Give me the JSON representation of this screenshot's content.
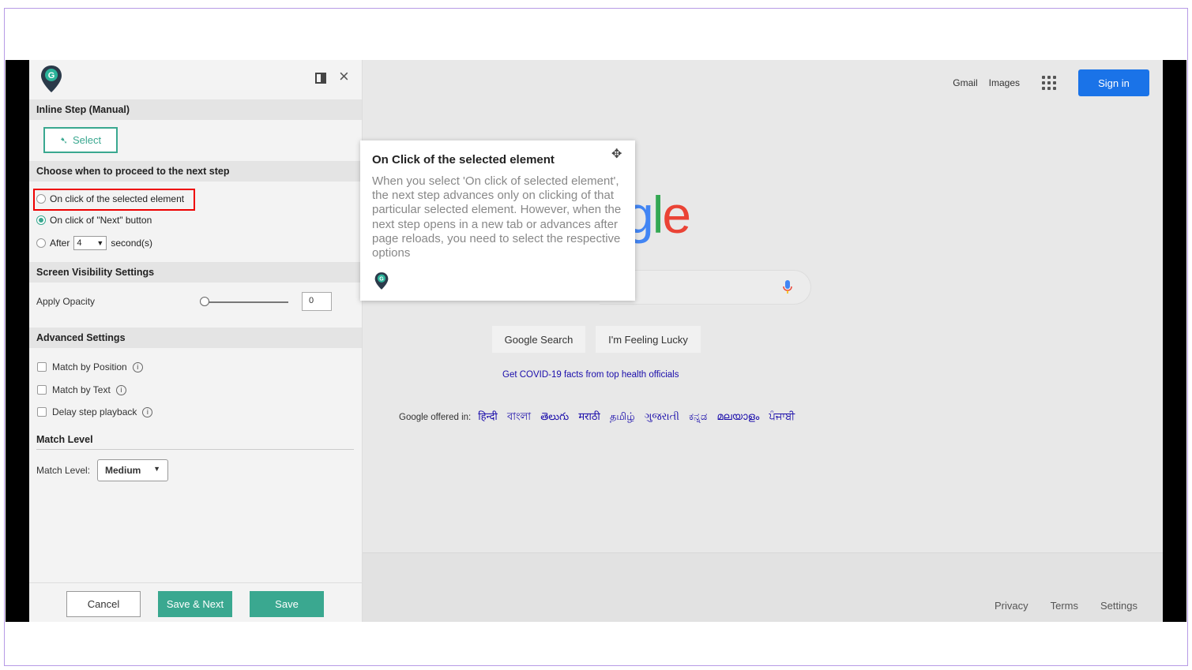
{
  "panel": {
    "sections": {
      "inline_step": "Inline Step (Manual)",
      "proceed": "Choose when to proceed to the next step",
      "visibility": "Screen Visibility Settings",
      "advanced": "Advanced Settings",
      "match_level": "Match Level"
    },
    "select_label": "Select",
    "radios": {
      "on_click_selected": "On click of the selected element",
      "on_click_next": "On click of \"Next\" button",
      "after": "After",
      "after_value": "4",
      "seconds": "second(s)"
    },
    "opacity": {
      "label": "Apply Opacity",
      "value": "0"
    },
    "advanced": {
      "match_position": "Match by Position",
      "match_text": "Match by Text",
      "delay_playback": "Delay step playback"
    },
    "match_level": {
      "label": "Match Level:",
      "value": "Medium"
    },
    "buttons": {
      "cancel": "Cancel",
      "save_next": "Save & Next",
      "save": "Save"
    }
  },
  "google": {
    "top": {
      "gmail": "Gmail",
      "images": "Images",
      "signin": "Sign in"
    },
    "logo_partial": "gle",
    "search_btn": "Google Search",
    "lucky_btn": "I'm Feeling Lucky",
    "covid": "Get COVID-19 facts from top health officials",
    "offered_in": "Google offered in:",
    "languages": [
      "हिन्दी",
      "বাংলা",
      "తెలుగు",
      "मराठी",
      "தமிழ்",
      "ગુજરાતી",
      "ಕನ್ನಡ",
      "മലയാളം",
      "ਪੰਜਾਬੀ"
    ],
    "footer": {
      "privacy": "Privacy",
      "terms": "Terms",
      "settings": "Settings"
    }
  },
  "tooltip": {
    "title": "On Click of the selected element",
    "body": "When you select 'On click of selected element', the next step advances only on clicking of that particular selected element. However, when the next step opens in a new tab or advances after page reloads, you need to select the respective options"
  },
  "colors": {
    "accent": "#3aa890",
    "signin": "#1a73e8",
    "highlight": "#ee0000"
  }
}
